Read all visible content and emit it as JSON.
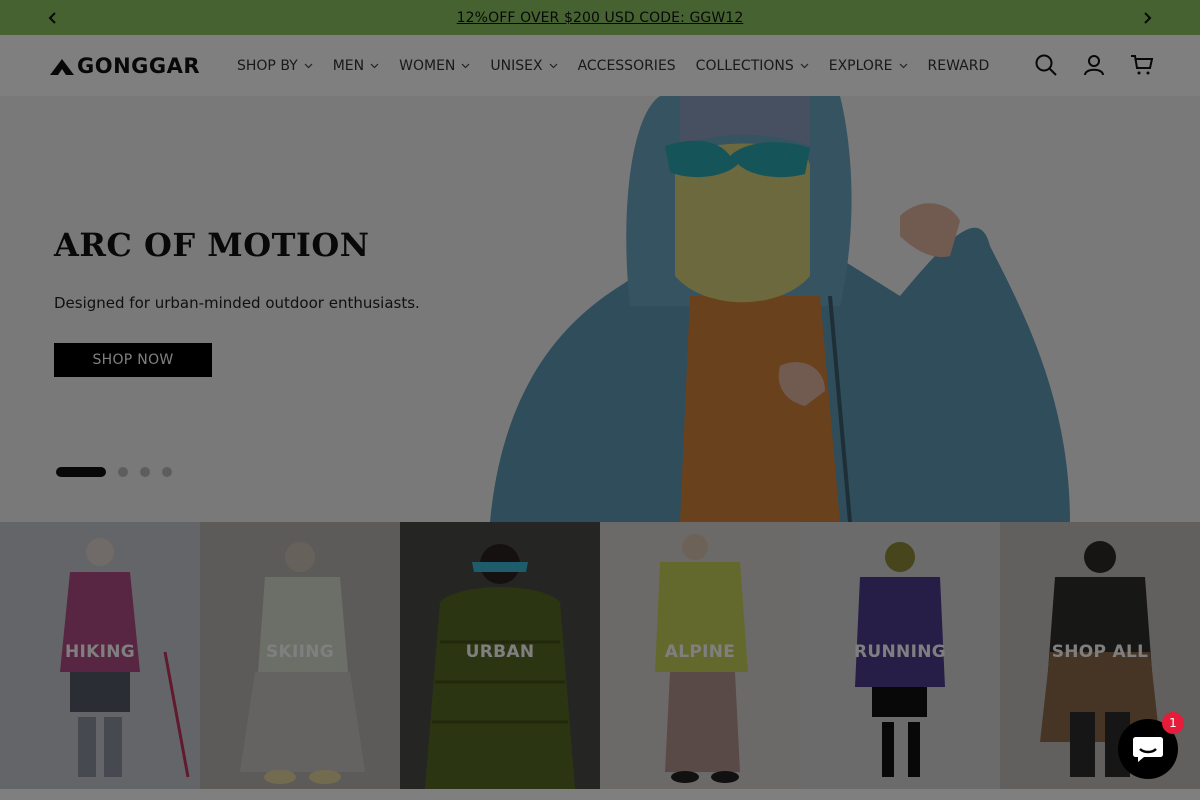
{
  "announcement": {
    "message": "12%OFF OVER $200 USD CODE: GGW12",
    "prev_icon": "chevron-left-icon",
    "next_icon": "chevron-right-icon"
  },
  "header": {
    "logo_text": "GONGGAR",
    "nav": [
      {
        "label": "SHOP BY",
        "dropdown": true
      },
      {
        "label": "MEN",
        "dropdown": true
      },
      {
        "label": "WOMEN",
        "dropdown": true
      },
      {
        "label": "UNISEX",
        "dropdown": true
      },
      {
        "label": "ACCESSORIES",
        "dropdown": false
      },
      {
        "label": "COLLECTIONS",
        "dropdown": true
      },
      {
        "label": "EXPLORE",
        "dropdown": true
      },
      {
        "label": "REWARD",
        "dropdown": false
      }
    ],
    "icons": [
      "search-icon",
      "account-icon",
      "cart-icon"
    ]
  },
  "hero": {
    "title": "ARC OF MOTION",
    "subtitle": "Designed for urban-minded outdoor enthusiasts.",
    "cta": "SHOP NOW",
    "slides_total": 4,
    "active_slide": 1
  },
  "categories": [
    {
      "label": "HIKING"
    },
    {
      "label": "SKIING"
    },
    {
      "label": "URBAN"
    },
    {
      "label": "ALPINE"
    },
    {
      "label": "RUNNING"
    },
    {
      "label": "SHOP ALL"
    }
  ],
  "chat": {
    "badge_count": "1",
    "icon": "chat-bubble-icon"
  },
  "colors": {
    "announcement_bg": "#8cc561",
    "overlay": "rgba(0,0,0,0.5)",
    "chat_bg": "#000000",
    "badge": "#e51c3a"
  }
}
